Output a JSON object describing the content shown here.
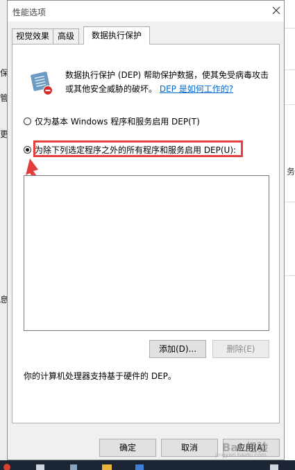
{
  "background": {
    "left_fragments": [
      "保",
      "管",
      "更",
      "息"
    ],
    "right_fragments": [
      "务"
    ]
  },
  "dialog": {
    "title": "性能选项",
    "tabs": [
      {
        "label": "视觉效果"
      },
      {
        "label": "高级"
      },
      {
        "label": "数据执行保护"
      }
    ],
    "description": "数据执行保护 (DEP) 帮助保护数据，使其免受病毒攻击或其他安全威胁的破坏。",
    "help_link": "DEP 是如何工作的?",
    "option_essential": "仅为基本 Windows 程序和服务启用 DEP(T)",
    "option_all_except": "为除下列选定程序之外的所有程序和服务启用 DEP(U):",
    "add_button": "添加(D)...",
    "remove_button": "删除(E)",
    "support_text": "你的计算机处理器支持基于硬件的 DEP。",
    "ok_button": "确定",
    "cancel_button": "取消",
    "apply_button": "应用(A)"
  },
  "watermark": {
    "main": "Bai 经验",
    "sub": "jingyan.baidu.com"
  }
}
